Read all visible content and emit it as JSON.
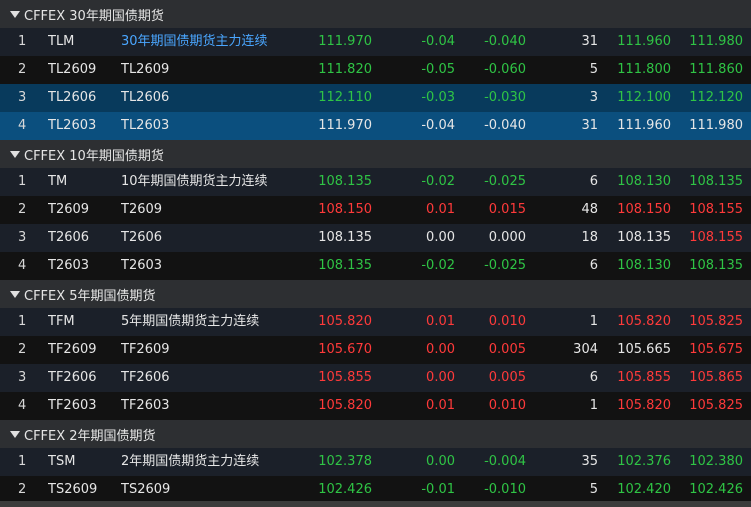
{
  "colors": {
    "up": "#ff3a3a",
    "down": "#2fc445",
    "flat": "#e6e6e6",
    "link": "#4aa6ff",
    "header_bg": "#2d2f32",
    "selected_bg": "#083a5c",
    "selected_strong_bg": "#0b4f7e"
  },
  "icons": {
    "group_toggle": "triangle-down-icon"
  },
  "groups": [
    {
      "title": "CFFEX 30年期国债期货",
      "rows": [
        {
          "idx": "1",
          "code": "TLM",
          "name": "30年期国债期货主力连续",
          "last": "111.970",
          "chg": "-0.04",
          "pct": "-0.040",
          "vol": "31",
          "bid": "111.960",
          "ask": "111.980",
          "last_dir": "down",
          "chg_dir": "down",
          "pct_dir": "down",
          "bid_dir": "down",
          "ask_dir": "down",
          "name_link": true,
          "state": "normal"
        },
        {
          "idx": "2",
          "code": "TL2609",
          "name": "TL2609",
          "last": "111.820",
          "chg": "-0.05",
          "pct": "-0.060",
          "vol": "5",
          "bid": "111.800",
          "ask": "111.860",
          "last_dir": "down",
          "chg_dir": "down",
          "pct_dir": "down",
          "bid_dir": "down",
          "ask_dir": "down",
          "name_link": false,
          "state": "normal"
        },
        {
          "idx": "3",
          "code": "TL2606",
          "name": "TL2606",
          "last": "112.110",
          "chg": "-0.03",
          "pct": "-0.030",
          "vol": "3",
          "bid": "112.100",
          "ask": "112.120",
          "last_dir": "down",
          "chg_dir": "down",
          "pct_dir": "down",
          "bid_dir": "down",
          "ask_dir": "down",
          "name_link": false,
          "state": "selected"
        },
        {
          "idx": "4",
          "code": "TL2603",
          "name": "TL2603",
          "last": "111.970",
          "chg": "-0.04",
          "pct": "-0.040",
          "vol": "31",
          "bid": "111.960",
          "ask": "111.980",
          "last_dir": "flat",
          "chg_dir": "flat",
          "pct_dir": "flat",
          "bid_dir": "flat",
          "ask_dir": "flat",
          "name_link": false,
          "state": "selected-strong"
        }
      ]
    },
    {
      "title": "CFFEX 10年期国债期货",
      "rows": [
        {
          "idx": "1",
          "code": "TM",
          "name": "10年期国债期货主力连续",
          "last": "108.135",
          "chg": "-0.02",
          "pct": "-0.025",
          "vol": "6",
          "bid": "108.130",
          "ask": "108.135",
          "last_dir": "down",
          "chg_dir": "down",
          "pct_dir": "down",
          "bid_dir": "down",
          "ask_dir": "down",
          "name_link": false,
          "state": "normal"
        },
        {
          "idx": "2",
          "code": "T2609",
          "name": "T2609",
          "last": "108.150",
          "chg": "0.01",
          "pct": "0.015",
          "vol": "48",
          "bid": "108.150",
          "ask": "108.155",
          "last_dir": "up",
          "chg_dir": "up",
          "pct_dir": "up",
          "bid_dir": "up",
          "ask_dir": "up",
          "name_link": false,
          "state": "normal"
        },
        {
          "idx": "3",
          "code": "T2606",
          "name": "T2606",
          "last": "108.135",
          "chg": "0.00",
          "pct": "0.000",
          "vol": "18",
          "bid": "108.135",
          "ask": "108.155",
          "last_dir": "flat",
          "chg_dir": "flat",
          "pct_dir": "flat",
          "bid_dir": "flat",
          "ask_dir": "up",
          "name_link": false,
          "state": "normal"
        },
        {
          "idx": "4",
          "code": "T2603",
          "name": "T2603",
          "last": "108.135",
          "chg": "-0.02",
          "pct": "-0.025",
          "vol": "6",
          "bid": "108.130",
          "ask": "108.135",
          "last_dir": "down",
          "chg_dir": "down",
          "pct_dir": "down",
          "bid_dir": "down",
          "ask_dir": "down",
          "name_link": false,
          "state": "normal"
        }
      ]
    },
    {
      "title": "CFFEX 5年期国债期货",
      "rows": [
        {
          "idx": "1",
          "code": "TFM",
          "name": "5年期国债期货主力连续",
          "last": "105.820",
          "chg": "0.01",
          "pct": "0.010",
          "vol": "1",
          "bid": "105.820",
          "ask": "105.825",
          "last_dir": "up",
          "chg_dir": "up",
          "pct_dir": "up",
          "bid_dir": "up",
          "ask_dir": "up",
          "name_link": false,
          "state": "normal"
        },
        {
          "idx": "2",
          "code": "TF2609",
          "name": "TF2609",
          "last": "105.670",
          "chg": "0.00",
          "pct": "0.005",
          "vol": "304",
          "bid": "105.665",
          "ask": "105.675",
          "last_dir": "up",
          "chg_dir": "up",
          "pct_dir": "up",
          "bid_dir": "flat",
          "ask_dir": "up",
          "name_link": false,
          "state": "normal"
        },
        {
          "idx": "3",
          "code": "TF2606",
          "name": "TF2606",
          "last": "105.855",
          "chg": "0.00",
          "pct": "0.005",
          "vol": "6",
          "bid": "105.855",
          "ask": "105.865",
          "last_dir": "up",
          "chg_dir": "up",
          "pct_dir": "up",
          "bid_dir": "up",
          "ask_dir": "up",
          "name_link": false,
          "state": "normal"
        },
        {
          "idx": "4",
          "code": "TF2603",
          "name": "TF2603",
          "last": "105.820",
          "chg": "0.01",
          "pct": "0.010",
          "vol": "1",
          "bid": "105.820",
          "ask": "105.825",
          "last_dir": "up",
          "chg_dir": "up",
          "pct_dir": "up",
          "bid_dir": "up",
          "ask_dir": "up",
          "name_link": false,
          "state": "normal"
        }
      ]
    },
    {
      "title": "CFFEX 2年期国债期货",
      "rows": [
        {
          "idx": "1",
          "code": "TSM",
          "name": "2年期国债期货主力连续",
          "last": "102.378",
          "chg": "0.00",
          "pct": "-0.004",
          "vol": "35",
          "bid": "102.376",
          "ask": "102.380",
          "last_dir": "down",
          "chg_dir": "down",
          "pct_dir": "down",
          "bid_dir": "down",
          "ask_dir": "down",
          "name_link": false,
          "state": "normal"
        },
        {
          "idx": "2",
          "code": "TS2609",
          "name": "TS2609",
          "last": "102.426",
          "chg": "-0.01",
          "pct": "-0.010",
          "vol": "5",
          "bid": "102.420",
          "ask": "102.426",
          "last_dir": "down",
          "chg_dir": "down",
          "pct_dir": "down",
          "bid_dir": "down",
          "ask_dir": "down",
          "name_link": false,
          "state": "normal"
        }
      ]
    }
  ]
}
